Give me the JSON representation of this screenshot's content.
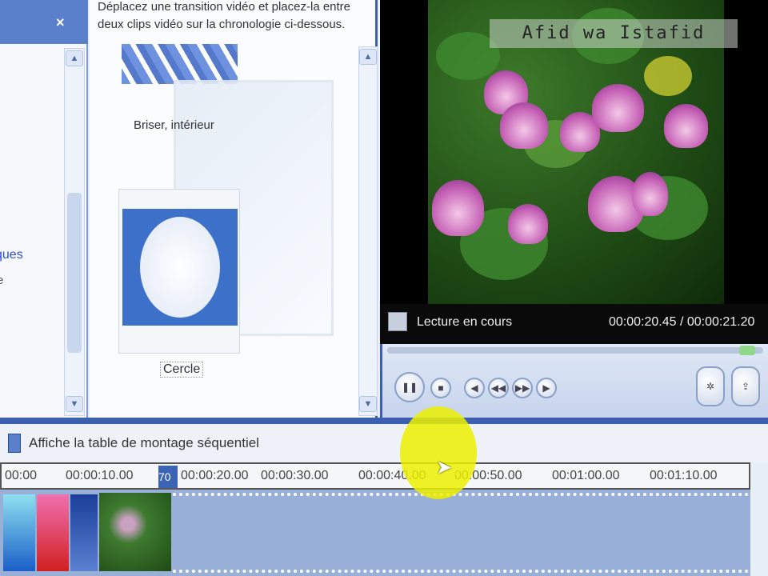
{
  "left_pane": {
    "close": "×",
    "partial_link": "ques",
    "partial_text": "e"
  },
  "tasks": {
    "instruction": "Déplacez une transition vidéo et placez-la entre deux clips vidéo sur la chronologie ci-dessous.",
    "items": [
      {
        "label": "Briser, intérieur"
      },
      {
        "label": "Cercle"
      }
    ]
  },
  "preview": {
    "watermark": "Afid wa Istafid",
    "status": "Lecture en cours",
    "time": "00:00:20.45 / 00:00:21.20",
    "progress": 0.96
  },
  "storyboard": {
    "label": "Affiche la table de montage séquentiel"
  },
  "timeline": {
    "ticks": [
      "00:00",
      "00:00:10.00",
      "00:00:20.00",
      "00:00:30.00",
      "00:00:40.00",
      "00:00:50.00",
      "00:01:00.00",
      "00:01:10.00"
    ],
    "marker": "70"
  },
  "colors": {
    "accent": "#3c5fb0",
    "highlight": "#ebf000"
  }
}
